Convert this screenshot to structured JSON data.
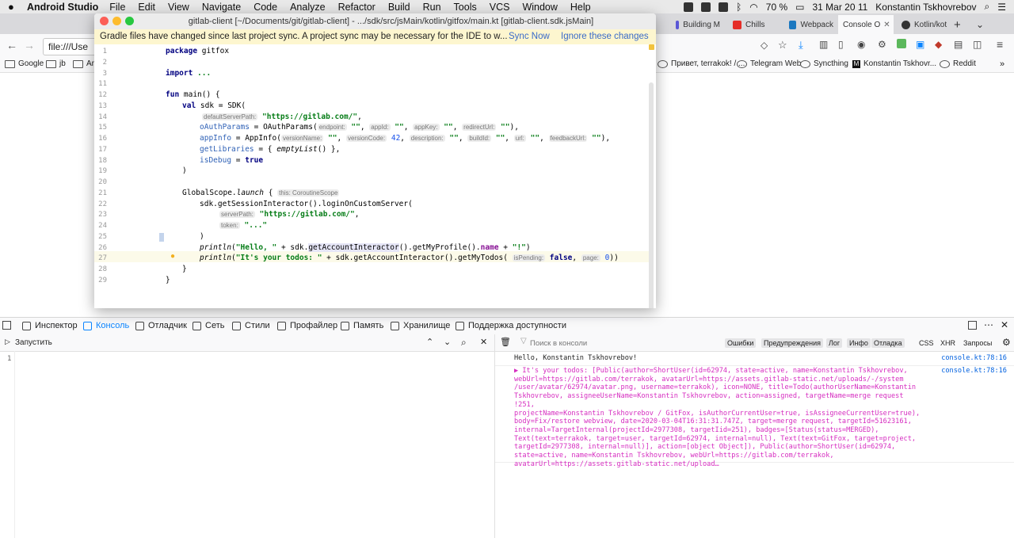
{
  "menubar": {
    "app_name": "Android Studio",
    "items": [
      "File",
      "Edit",
      "View",
      "Navigate",
      "Code",
      "Analyze",
      "Refactor",
      "Build",
      "Run",
      "Tools",
      "VCS",
      "Window",
      "Help"
    ],
    "battery": "70 %",
    "datetime": "31 Mar  20 11",
    "user": "Konstantin Tskhovrebov"
  },
  "browser": {
    "tabs": [
      {
        "label": "Building M",
        "color": "#5a57d6"
      },
      {
        "label": "Chills",
        "color": "#e52d27"
      },
      {
        "label": "Webpack",
        "color": "#1c78c0"
      },
      {
        "label": "Console O",
        "color": "#888888",
        "active": true
      },
      {
        "label": "Kotlin/kot",
        "color": "#333333"
      }
    ],
    "url": "file:///Use",
    "bookmarks": [
      "Google",
      "jb",
      "And",
      "Привет, terrakok! / ...",
      "Telegram Web",
      "Syncthing",
      "Konstantin Tskhovr...",
      "Reddit"
    ]
  },
  "studio": {
    "title": "gitlab-client [~/Documents/git/gitlab-client] - .../sdk/src/jsMain/kotlin/gitfox/main.kt [gitlab-client.sdk.jsMain]",
    "notification": "Gradle files have changed since last project sync. A project sync may be necessary for the IDE to w...",
    "sync_now": "Sync Now",
    "ignore": "Ignore these changes",
    "line_numbers": [
      "1",
      "2",
      "3",
      "11",
      "12",
      "13",
      "14",
      "15",
      "16",
      "17",
      "18",
      "19",
      "20",
      "21",
      "22",
      "23",
      "24",
      "25",
      "26",
      "27",
      "28",
      "29"
    ],
    "code": {
      "l1_kw": "package",
      "l1_rest": " gitfox",
      "l3_kw": "import",
      "l3_rest": " ...",
      "l12_kw": "fun",
      "l12_rest": " main() {",
      "l13_kw": "val",
      "l13_rest": " sdk = SDK(",
      "l14_hint": "defaultServerPath:",
      "l14_str": "\"https://gitlab.com/\"",
      "l15_name": "oAuthParams",
      "l15_mid": " = OAuthParams(",
      "l15_h1": "endpoint:",
      "l15_s1": "\"\"",
      "l15_h2": "appId:",
      "l15_s2": "\"\"",
      "l15_h3": "appKey:",
      "l15_s3": "\"\"",
      "l15_h4": "redirectUrl:",
      "l15_s4": "\"\"",
      "l15_end": "),",
      "l16_name": "appInfo",
      "l16_mid": " = AppInfo(",
      "l16_h1": "versionName:",
      "l16_s1": "\"\"",
      "l16_h2": "versionCode:",
      "l16_n2": "42",
      "l16_h3": "description:",
      "l16_s3": "\"\"",
      "l16_h4": "buildId:",
      "l16_s4": "\"\"",
      "l16_h5": "url:",
      "l16_s5": "\"\"",
      "l16_h6": "feedbackUrl:",
      "l16_s6": "\"\"",
      "l16_end": "),",
      "l17_name": "getLibraries",
      "l17_mid": " = { ",
      "l17_it": "emptyList",
      "l17_end": "() },",
      "l18_name": "isDebug",
      "l18_mid": " = ",
      "l18_kw": "true",
      "l19": ")",
      "l21_a": "GlobalScope.",
      "l21_it": "launch",
      "l21_b": " {",
      "l21_hint": "this: CoroutineScope",
      "l22": "sdk.getSessionInteractor().loginOnCustomServer(",
      "l23_hint": "serverPath:",
      "l23_str": "\"https://gitlab.com/\"",
      "l24_hint": "token:",
      "l24_str": "\"...\"",
      "l25": ")",
      "l26_it": "println",
      "l26_a": "(",
      "l26_str": "\"Hello, \"",
      "l26_b": " + sdk.",
      "l26_hl": "getAccountInteractor",
      "l26_c": "().getMyProfile().",
      "l26_fld": "name",
      "l26_d": " + ",
      "l26_str2": "\"!\"",
      "l26_e": ")",
      "l27_it": "println",
      "l27_a": "(",
      "l27_str": "\"It's your todos: \"",
      "l27_b": " + sdk.",
      "l27_hl": "getAccountInteractor",
      "l27_c": "().getMyTodos(",
      "l27_h1": "isPending:",
      "l27_kw": "false",
      "l27_h2": "page:",
      "l27_n": "0",
      "l27_end": "))",
      "l28": "}",
      "l29": "}"
    }
  },
  "devtools": {
    "tabs": [
      "Инспектор",
      "Консоль",
      "Отладчик",
      "Сеть",
      "Стили",
      "Профайлер",
      "Память",
      "Хранилище",
      "Поддержка доступности"
    ],
    "run_label": "Запустить",
    "editor_line": "1",
    "filter_placeholder": "Поиск в консоли",
    "filters": [
      "Ошибки",
      "Предупреждения",
      "Лог",
      "Инфо",
      "Отладка"
    ],
    "extra_filters": [
      "CSS",
      "XHR",
      "Запросы"
    ],
    "messages": [
      {
        "text": "Hello, Konstantin Tskhovrebov!",
        "source": "console.kt:78:16"
      },
      {
        "lines": [
          "▶ It's your todos: [Public(author=ShortUser(id=62974, state=active, name=Konstantin Tskhovrebov,",
          "webUrl=https://gitlab.com/terrakok, avatarUrl=https://assets.gitlab-static.net/uploads/-/system",
          "/user/avatar/62974/avatar.png, username=terrakok), icon=NONE, title=Todo(authorUserName=Konstantin",
          "Tskhovrebov, assigneeUserName=Konstantin Tskhovrebov, action=assigned, targetName=merge request !251,",
          "projectName=Konstantin Tskhovrebov / GitFox, isAuthorCurrentUser=true, isAssigneeCurrentUser=true),",
          "body=Fix/restore webview, date=2020-03-04T16:31:31.747Z, target=merge request, targetId=51623161,",
          "internal=TargetInternal(projectId=2977308, targetIid=251), badges=[Status(status=MERGED),",
          "Text(text=terrakok, target=user, targetId=62974, internal=null), Text(text=GitFox, target=project,",
          "targetId=2977308, internal=null)], action=[object Object]), Public(author=ShortUser(id=62974,",
          "state=active, name=Konstantin Tskhovrebov, webUrl=https://gitlab.com/terrakok,",
          "avatarUrl=https://assets.gitlab-static.net/upload…"
        ],
        "source": "console.kt:78:16",
        "color": "#d62dc0"
      }
    ]
  }
}
